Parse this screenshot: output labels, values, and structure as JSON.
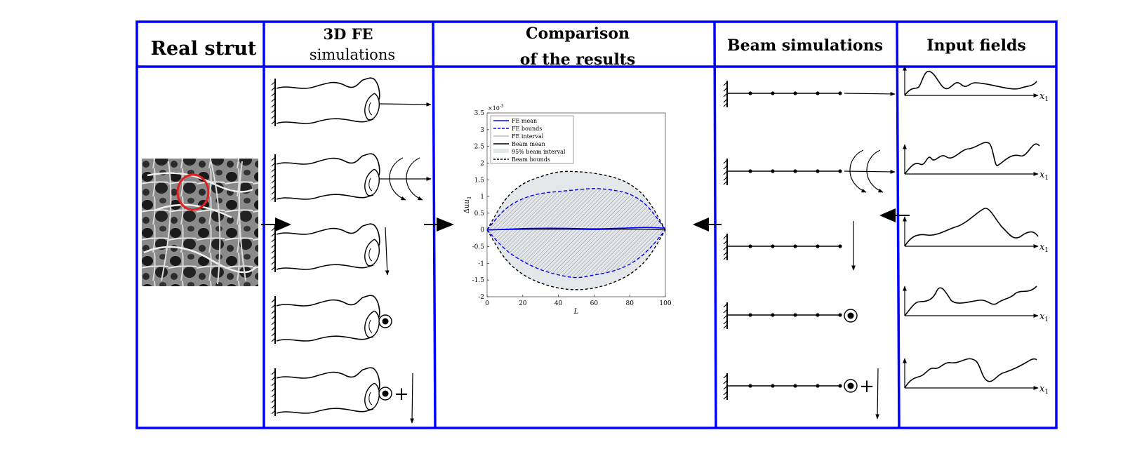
{
  "headers": {
    "real": "Real strut",
    "fe_line1": "3D FE",
    "fe_line2": "simulations",
    "cmp_line1": "Comparison",
    "cmp_line2": "of the results",
    "beam": "Beam simulations",
    "input": "Input fields"
  },
  "colors": {
    "frame": "#0000ff",
    "ink": "#000000",
    "strut_marker": "#e02020",
    "fe_series": "#0000ff",
    "beam_band": "#d9dde1"
  },
  "load_cases": [
    "axial-force",
    "bending-moment",
    "transverse-force",
    "torsion-moment",
    "torsion-plus-transverse"
  ],
  "input_axis_label": "x",
  "input_axis_subscript": "1",
  "plus_sign": "+",
  "chart_data": {
    "type": "line",
    "xlabel": "L",
    "ylabel": "Δu",
    "ylabel_subscript": "1",
    "y_multiplier": "×10",
    "y_multiplier_exp": "-3",
    "xlim": [
      0,
      100
    ],
    "ylim": [
      -2,
      3.5
    ],
    "xticks": [
      0,
      20,
      40,
      60,
      80,
      100
    ],
    "yticks": [
      3.5,
      3,
      2.5,
      2,
      1.5,
      1,
      0.5,
      0,
      -0.5,
      -1,
      -1.5,
      -2
    ],
    "legend": [
      "FE mean",
      "FE bounds",
      "FE interval",
      "Beam mean",
      "95% beam interval",
      "Beam bounds"
    ],
    "legend_position": "top-left",
    "grid": false,
    "x": [
      0,
      10,
      20,
      30,
      40,
      50,
      60,
      70,
      80,
      90,
      100
    ],
    "series": [
      {
        "name": "FE mean",
        "values": [
          0,
          0.02,
          0.04,
          0.05,
          0.05,
          0.04,
          0.03,
          0.04,
          0.06,
          0.08,
          0.05
        ]
      },
      {
        "name": "FE bounds",
        "upper": [
          0,
          0.65,
          0.95,
          1.1,
          1.15,
          1.2,
          1.25,
          1.2,
          1.1,
          0.75,
          0
        ],
        "lower": [
          0,
          -0.6,
          -0.95,
          -1.2,
          -1.35,
          -1.45,
          -1.35,
          -1.25,
          -1.05,
          -0.65,
          0
        ]
      },
      {
        "name": "Beam mean",
        "values": [
          0,
          0.01,
          0.02,
          0.02,
          0.02,
          0.02,
          0.01,
          0.02,
          0.02,
          0.02,
          0
        ]
      },
      {
        "name": "Beam bounds",
        "upper": [
          0,
          0.95,
          1.4,
          1.6,
          1.75,
          1.75,
          1.7,
          1.6,
          1.4,
          0.95,
          0
        ],
        "lower": [
          0,
          -0.9,
          -1.35,
          -1.6,
          -1.75,
          -1.8,
          -1.75,
          -1.6,
          -1.35,
          -0.9,
          0
        ]
      }
    ]
  }
}
